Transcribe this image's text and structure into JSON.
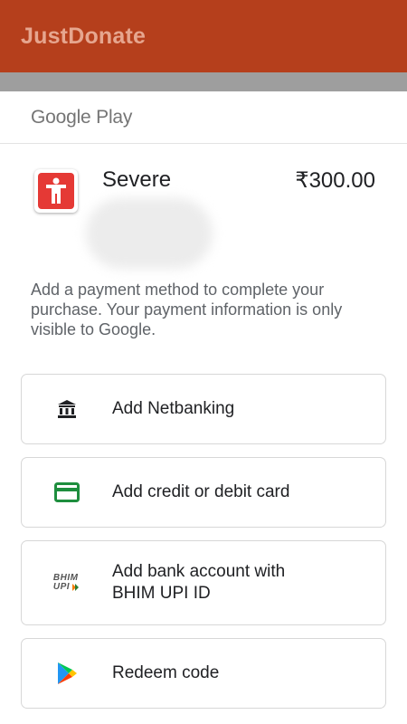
{
  "appbar": {
    "title": "JustDonate"
  },
  "sheet": {
    "provider_logo_text": "Google Play",
    "product": {
      "title": "Severe",
      "price": "₹300.00"
    },
    "info_text": "Add a payment method to complete your purchase. Your payment information is only visible to Google.",
    "options": [
      {
        "label": "Add Netbanking",
        "icon": "bank-icon"
      },
      {
        "label": "Add credit or debit card",
        "icon": "credit-card-icon",
        "color": "#1e8e3e"
      },
      {
        "label_line1": "Add bank account with",
        "label_line2": "BHIM UPI ID",
        "icon": "bhim-upi-icon",
        "icon_text_1": "BHIM",
        "icon_text_2": "UPI"
      },
      {
        "label": "Redeem code",
        "icon": "google-play-icon"
      }
    ]
  },
  "colors": {
    "appbar": "#b53f1c",
    "appbar_title": "#e6a68f",
    "app_icon": "#e53935"
  }
}
